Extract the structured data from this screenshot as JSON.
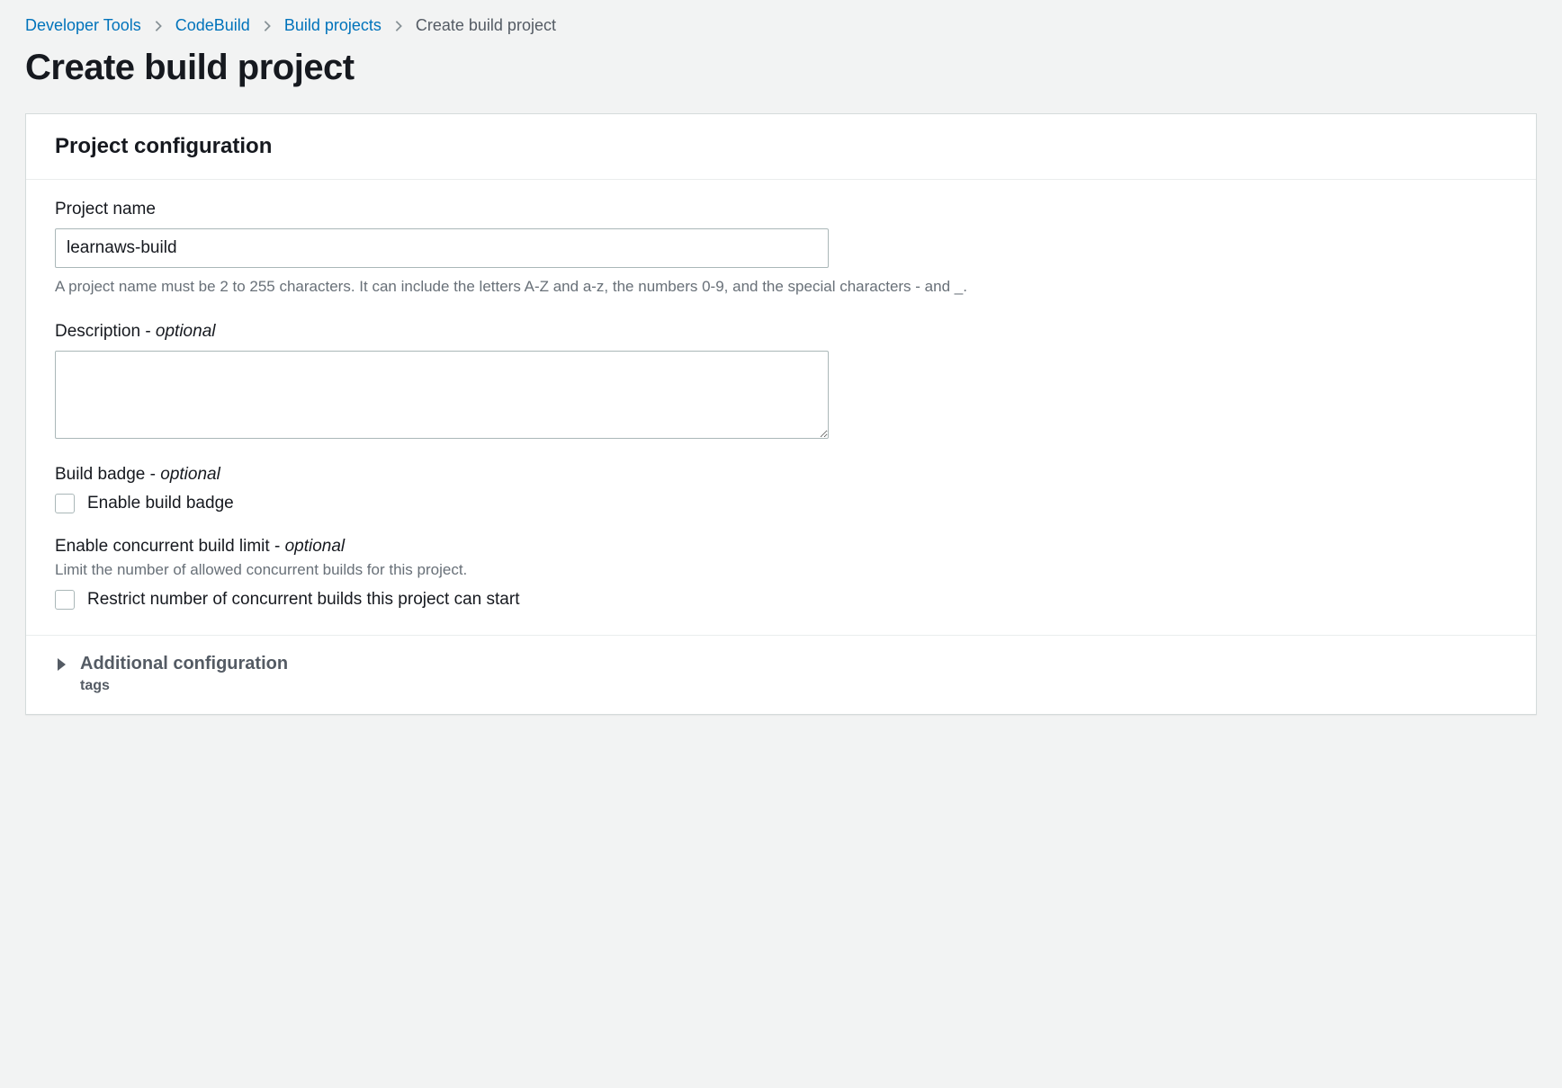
{
  "breadcrumb": {
    "items": [
      {
        "label": "Developer Tools",
        "link": true
      },
      {
        "label": "CodeBuild",
        "link": true
      },
      {
        "label": "Build projects",
        "link": true
      },
      {
        "label": "Create build project",
        "link": false
      }
    ]
  },
  "page": {
    "title": "Create build project"
  },
  "panel": {
    "header": "Project configuration"
  },
  "project_name": {
    "label": "Project name",
    "value": "learnaws-build",
    "hint": "A project name must be 2 to 255 characters. It can include the letters A-Z and a-z, the numbers 0-9, and the special characters - and _."
  },
  "description": {
    "label_pre": "Description - ",
    "label_opt": "optional",
    "value": ""
  },
  "build_badge": {
    "label_pre": "Build badge - ",
    "label_opt": "optional",
    "checkbox_label": "Enable build badge"
  },
  "concurrent_limit": {
    "label_pre": "Enable concurrent build limit - ",
    "label_opt": "optional",
    "hint": "Limit the number of allowed concurrent builds for this project.",
    "checkbox_label": "Restrict number of concurrent builds this project can start"
  },
  "additional_config": {
    "title": "Additional configuration",
    "sub": "tags"
  }
}
